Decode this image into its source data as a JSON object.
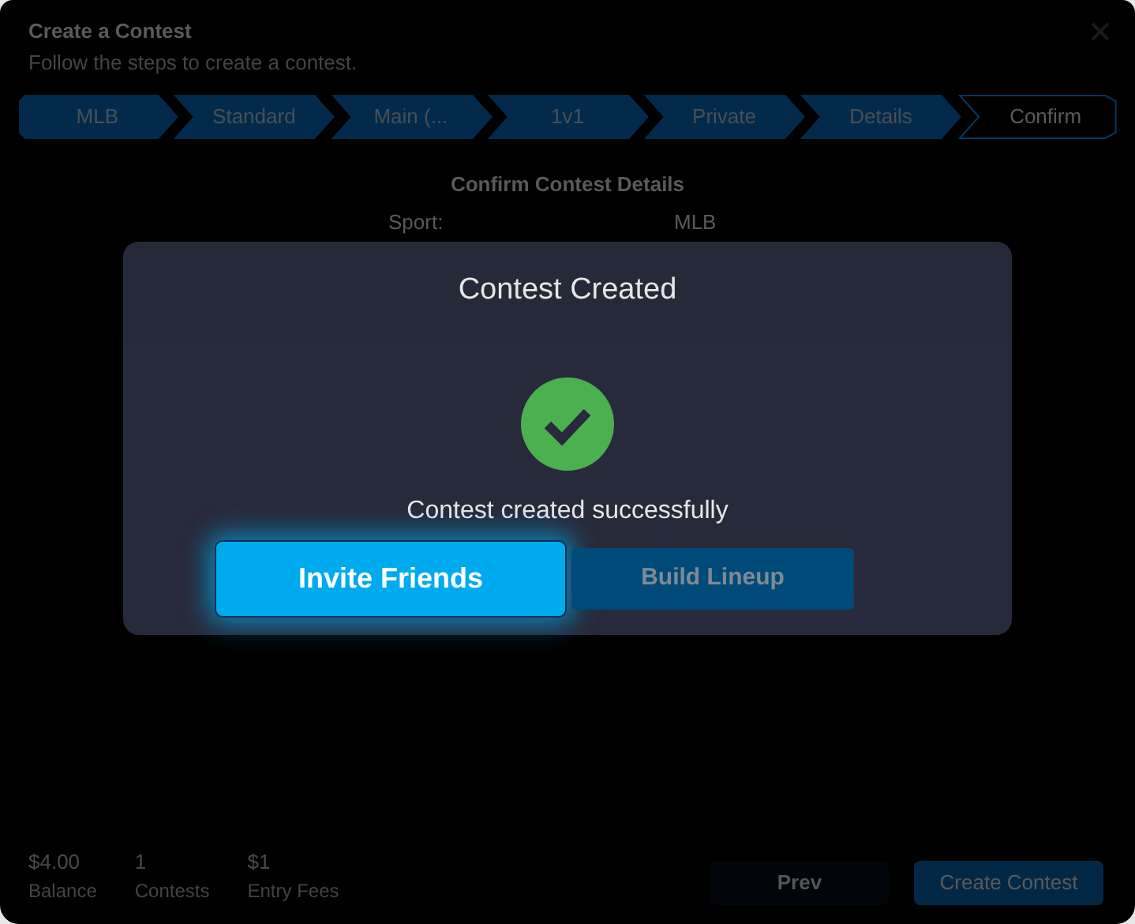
{
  "page": {
    "title": "Create a Contest",
    "subtitle": "Follow the steps to create a contest."
  },
  "steps": [
    {
      "label": "MLB",
      "selected": false
    },
    {
      "label": "Standard",
      "selected": false
    },
    {
      "label": "Main (...",
      "selected": false
    },
    {
      "label": "1v1",
      "selected": false
    },
    {
      "label": "Private",
      "selected": false
    },
    {
      "label": "Details",
      "selected": false
    },
    {
      "label": "Confirm",
      "selected": true
    }
  ],
  "section_title": "Confirm Contest Details",
  "details": [
    {
      "label": "Sport:",
      "value": "MLB"
    }
  ],
  "stats": [
    {
      "value": "$4.00",
      "label": "Balance"
    },
    {
      "value": "1",
      "label": "Contests"
    },
    {
      "value": "$1",
      "label": "Entry Fees"
    }
  ],
  "footer_buttons": [
    {
      "label": "Prev",
      "kind": "secondary"
    },
    {
      "label": "Create Contest",
      "kind": "primary"
    }
  ],
  "modal": {
    "title": "Contest Created",
    "message": "Contest created successfully",
    "buttons": [
      {
        "label": "Invite Friends",
        "selected": true
      },
      {
        "label": "Build Lineup",
        "selected": false
      }
    ]
  }
}
